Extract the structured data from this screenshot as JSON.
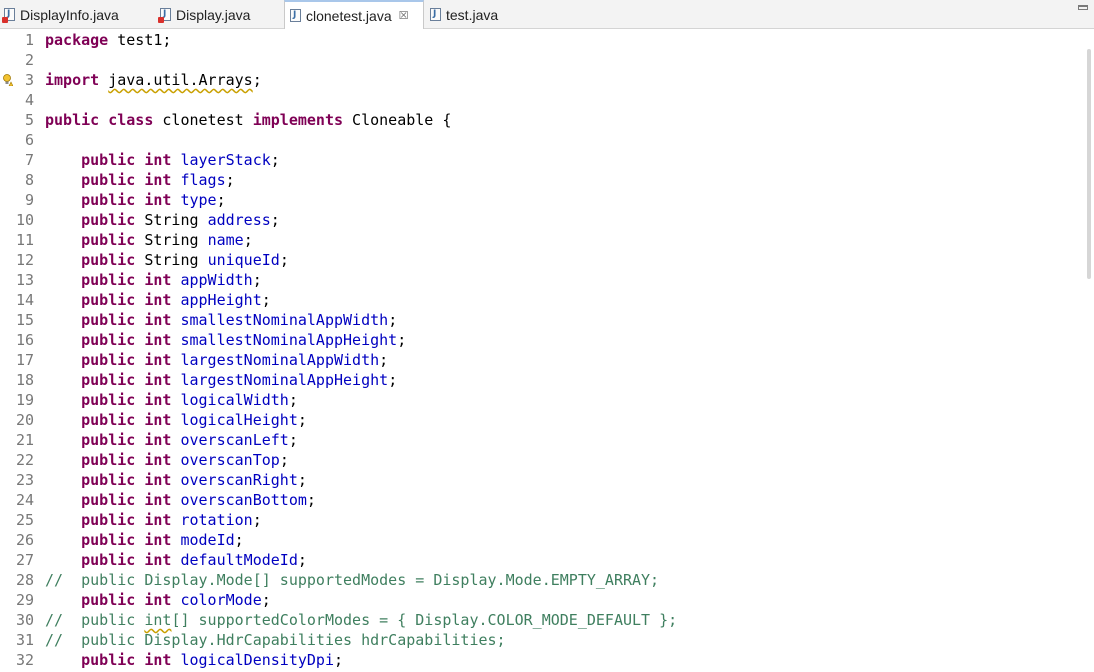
{
  "tabs": [
    {
      "label": "DisplayInfo.java",
      "active": false,
      "error": true
    },
    {
      "label": "Display.java",
      "active": false,
      "error": true
    },
    {
      "label": "clonetest.java",
      "active": true,
      "error": false,
      "close": "☒"
    },
    {
      "label": "test.java",
      "active": false,
      "error": false
    }
  ],
  "colors": {
    "keyword": "#7f0055",
    "field": "#0000c0",
    "comment": "#3f7f5f",
    "line_number": "#787878"
  },
  "editor": {
    "lines": [
      {
        "n": "1",
        "parts": [
          [
            "kw",
            "package"
          ],
          [
            "",
            " test1;"
          ]
        ]
      },
      {
        "n": "2",
        "parts": []
      },
      {
        "n": "3",
        "warning": true,
        "parts": [
          [
            "kw",
            "import"
          ],
          [
            "",
            " "
          ],
          [
            "warn",
            "java.util.Arrays"
          ],
          [
            "",
            ";"
          ]
        ]
      },
      {
        "n": "4",
        "parts": []
      },
      {
        "n": "5",
        "parts": [
          [
            "kw",
            "public"
          ],
          [
            "",
            " "
          ],
          [
            "kw",
            "class"
          ],
          [
            "",
            " clonetest "
          ],
          [
            "kw",
            "implements"
          ],
          [
            "",
            " Cloneable {"
          ]
        ]
      },
      {
        "n": "6",
        "parts": []
      },
      {
        "n": "7",
        "parts": [
          [
            "",
            "    "
          ],
          [
            "kw",
            "public"
          ],
          [
            "",
            " "
          ],
          [
            "kw",
            "int"
          ],
          [
            "",
            " "
          ],
          [
            "fd",
            "layerStack"
          ],
          [
            "",
            ";"
          ]
        ]
      },
      {
        "n": "8",
        "parts": [
          [
            "",
            "    "
          ],
          [
            "kw",
            "public"
          ],
          [
            "",
            " "
          ],
          [
            "kw",
            "int"
          ],
          [
            "",
            " "
          ],
          [
            "fd",
            "flags"
          ],
          [
            "",
            ";"
          ]
        ]
      },
      {
        "n": "9",
        "parts": [
          [
            "",
            "    "
          ],
          [
            "kw",
            "public"
          ],
          [
            "",
            " "
          ],
          [
            "kw",
            "int"
          ],
          [
            "",
            " "
          ],
          [
            "fd",
            "type"
          ],
          [
            "",
            ";"
          ]
        ]
      },
      {
        "n": "10",
        "parts": [
          [
            "",
            "    "
          ],
          [
            "kw",
            "public"
          ],
          [
            "",
            " String "
          ],
          [
            "fd",
            "address"
          ],
          [
            "",
            ";"
          ]
        ]
      },
      {
        "n": "11",
        "parts": [
          [
            "",
            "    "
          ],
          [
            "kw",
            "public"
          ],
          [
            "",
            " String "
          ],
          [
            "fd",
            "name"
          ],
          [
            "",
            ";"
          ]
        ]
      },
      {
        "n": "12",
        "parts": [
          [
            "",
            "    "
          ],
          [
            "kw",
            "public"
          ],
          [
            "",
            " String "
          ],
          [
            "fd",
            "uniqueId"
          ],
          [
            "",
            ";"
          ]
        ]
      },
      {
        "n": "13",
        "parts": [
          [
            "",
            "    "
          ],
          [
            "kw",
            "public"
          ],
          [
            "",
            " "
          ],
          [
            "kw",
            "int"
          ],
          [
            "",
            " "
          ],
          [
            "fd",
            "appWidth"
          ],
          [
            "",
            ";"
          ]
        ]
      },
      {
        "n": "14",
        "parts": [
          [
            "",
            "    "
          ],
          [
            "kw",
            "public"
          ],
          [
            "",
            " "
          ],
          [
            "kw",
            "int"
          ],
          [
            "",
            " "
          ],
          [
            "fd",
            "appHeight"
          ],
          [
            "",
            ";"
          ]
        ]
      },
      {
        "n": "15",
        "parts": [
          [
            "",
            "    "
          ],
          [
            "kw",
            "public"
          ],
          [
            "",
            " "
          ],
          [
            "kw",
            "int"
          ],
          [
            "",
            " "
          ],
          [
            "fd",
            "smallestNominalAppWidth"
          ],
          [
            "",
            ";"
          ]
        ]
      },
      {
        "n": "16",
        "parts": [
          [
            "",
            "    "
          ],
          [
            "kw",
            "public"
          ],
          [
            "",
            " "
          ],
          [
            "kw",
            "int"
          ],
          [
            "",
            " "
          ],
          [
            "fd",
            "smallestNominalAppHeight"
          ],
          [
            "",
            ";"
          ]
        ]
      },
      {
        "n": "17",
        "parts": [
          [
            "",
            "    "
          ],
          [
            "kw",
            "public"
          ],
          [
            "",
            " "
          ],
          [
            "kw",
            "int"
          ],
          [
            "",
            " "
          ],
          [
            "fd",
            "largestNominalAppWidth"
          ],
          [
            "",
            ";"
          ]
        ]
      },
      {
        "n": "18",
        "parts": [
          [
            "",
            "    "
          ],
          [
            "kw",
            "public"
          ],
          [
            "",
            " "
          ],
          [
            "kw",
            "int"
          ],
          [
            "",
            " "
          ],
          [
            "fd",
            "largestNominalAppHeight"
          ],
          [
            "",
            ";"
          ]
        ]
      },
      {
        "n": "19",
        "parts": [
          [
            "",
            "    "
          ],
          [
            "kw",
            "public"
          ],
          [
            "",
            " "
          ],
          [
            "kw",
            "int"
          ],
          [
            "",
            " "
          ],
          [
            "fd",
            "logicalWidth"
          ],
          [
            "",
            ";"
          ]
        ]
      },
      {
        "n": "20",
        "parts": [
          [
            "",
            "    "
          ],
          [
            "kw",
            "public"
          ],
          [
            "",
            " "
          ],
          [
            "kw",
            "int"
          ],
          [
            "",
            " "
          ],
          [
            "fd",
            "logicalHeight"
          ],
          [
            "",
            ";"
          ]
        ]
      },
      {
        "n": "21",
        "parts": [
          [
            "",
            "    "
          ],
          [
            "kw",
            "public"
          ],
          [
            "",
            " "
          ],
          [
            "kw",
            "int"
          ],
          [
            "",
            " "
          ],
          [
            "fd",
            "overscanLeft"
          ],
          [
            "",
            ";"
          ]
        ]
      },
      {
        "n": "22",
        "parts": [
          [
            "",
            "    "
          ],
          [
            "kw",
            "public"
          ],
          [
            "",
            " "
          ],
          [
            "kw",
            "int"
          ],
          [
            "",
            " "
          ],
          [
            "fd",
            "overscanTop"
          ],
          [
            "",
            ";"
          ]
        ]
      },
      {
        "n": "23",
        "parts": [
          [
            "",
            "    "
          ],
          [
            "kw",
            "public"
          ],
          [
            "",
            " "
          ],
          [
            "kw",
            "int"
          ],
          [
            "",
            " "
          ],
          [
            "fd",
            "overscanRight"
          ],
          [
            "",
            ";"
          ]
        ]
      },
      {
        "n": "24",
        "parts": [
          [
            "",
            "    "
          ],
          [
            "kw",
            "public"
          ],
          [
            "",
            " "
          ],
          [
            "kw",
            "int"
          ],
          [
            "",
            " "
          ],
          [
            "fd",
            "overscanBottom"
          ],
          [
            "",
            ";"
          ]
        ]
      },
      {
        "n": "25",
        "parts": [
          [
            "",
            "    "
          ],
          [
            "kw",
            "public"
          ],
          [
            "",
            " "
          ],
          [
            "kw",
            "int"
          ],
          [
            "",
            " "
          ],
          [
            "fd",
            "rotation"
          ],
          [
            "",
            ";"
          ]
        ]
      },
      {
        "n": "26",
        "parts": [
          [
            "",
            "    "
          ],
          [
            "kw",
            "public"
          ],
          [
            "",
            " "
          ],
          [
            "kw",
            "int"
          ],
          [
            "",
            " "
          ],
          [
            "fd",
            "modeId"
          ],
          [
            "",
            ";"
          ]
        ]
      },
      {
        "n": "27",
        "parts": [
          [
            "",
            "    "
          ],
          [
            "kw",
            "public"
          ],
          [
            "",
            " "
          ],
          [
            "kw",
            "int"
          ],
          [
            "",
            " "
          ],
          [
            "fd",
            "defaultModeId"
          ],
          [
            "",
            ";"
          ]
        ]
      },
      {
        "n": "28",
        "parts": [
          [
            "cm",
            "//  public Display.Mode[] supportedModes = Display.Mode.EMPTY_ARRAY;"
          ]
        ]
      },
      {
        "n": "29",
        "parts": [
          [
            "",
            "    "
          ],
          [
            "kw",
            "public"
          ],
          [
            "",
            " "
          ],
          [
            "kw",
            "int"
          ],
          [
            "",
            " "
          ],
          [
            "fd",
            "colorMode"
          ],
          [
            "",
            ";"
          ]
        ]
      },
      {
        "n": "30",
        "parts": [
          [
            "cm",
            "//  public "
          ],
          [
            "cm warn",
            "int"
          ],
          [
            "cm",
            "[] supportedColorModes = { Display.COLOR_MODE_DEFAULT };"
          ]
        ]
      },
      {
        "n": "31",
        "parts": [
          [
            "cm",
            "//  public Display.HdrCapabilities hdrCapabilities;"
          ]
        ]
      },
      {
        "n": "32",
        "parts": [
          [
            "",
            "    "
          ],
          [
            "kw",
            "public"
          ],
          [
            "",
            " "
          ],
          [
            "kw",
            "int"
          ],
          [
            "",
            " "
          ],
          [
            "fd",
            "logicalDensityDpi"
          ],
          [
            "",
            ";"
          ]
        ]
      }
    ]
  }
}
